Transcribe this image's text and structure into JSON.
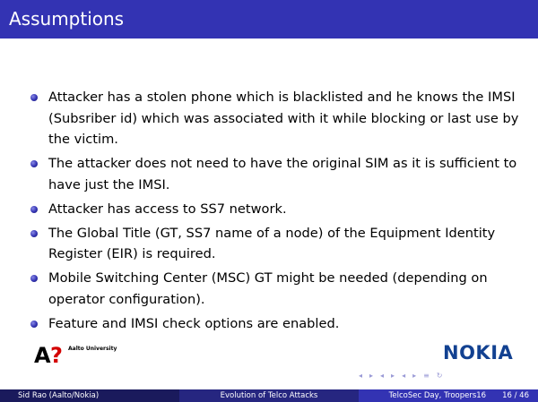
{
  "slide": {
    "title": "Assumptions",
    "bullets": [
      "Attacker has a stolen phone which is blacklisted and he knows the IMSI (Subsriber id) which was associated with it while blocking or last use by the victim.",
      "The attacker does not need to have the original SIM as it is sufficient to have just the IMSI.",
      "Attacker has access to SS7 network.",
      "The Global Title (GT, SS7 name of a node) of the Equipment Identity Register (EIR) is required.",
      "Mobile Switching Center (MSC) GT might be needed (depending on operator configuration).",
      "Feature and IMSI check options are enabled."
    ]
  },
  "logos": {
    "aalto_mark_a": "A",
    "aalto_mark_q": "?",
    "aalto_name": "Aalto University",
    "nokia": "NOKIA"
  },
  "navigation": {
    "icons": [
      "frame-prev-icon",
      "frame-next-icon",
      "subsection-prev-icon",
      "subsection-next-icon",
      "section-prev-icon",
      "section-next-icon",
      "align-icon",
      "search-icon"
    ],
    "symbols": [
      "◂",
      "▸",
      "◂",
      "▸",
      "◂",
      "▸",
      "≡",
      "↻"
    ]
  },
  "footer": {
    "author": "Sid Rao  (Aalto/Nokia)",
    "title": "Evolution of Telco Attacks",
    "event": "TelcoSec Day, Troopers16",
    "page": "16 / 46"
  },
  "colors": {
    "title_bar": "#3333b3",
    "footer_left": "#1a1a5c",
    "footer_middle": "#262680",
    "footer_right": "#3333b3",
    "nokia_blue": "#124191",
    "aalto_red": "#d40000"
  }
}
